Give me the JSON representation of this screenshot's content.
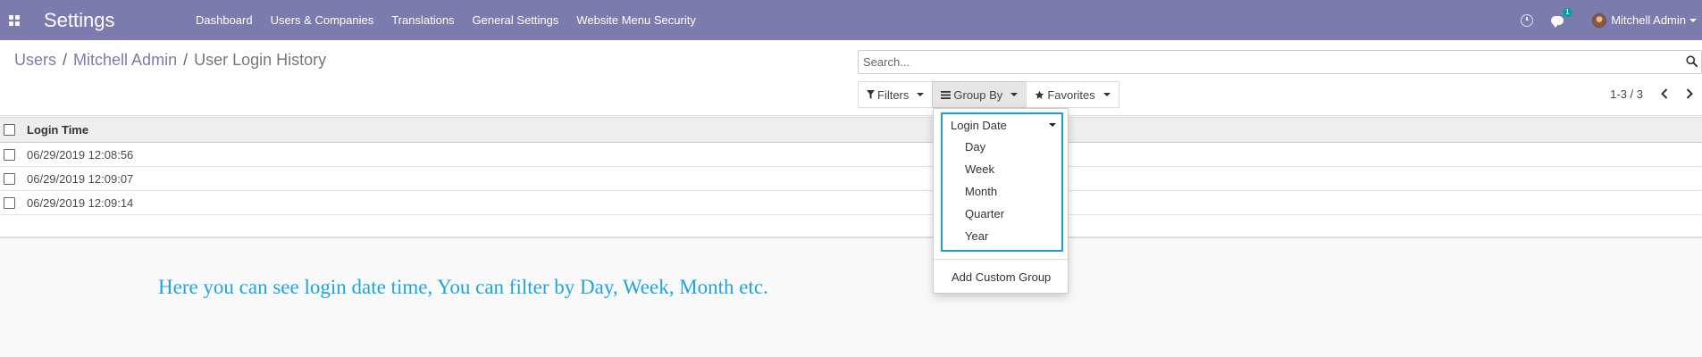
{
  "navbar": {
    "brand": "Settings",
    "menu": [
      "Dashboard",
      "Users & Companies",
      "Translations",
      "General Settings",
      "Website Menu Security"
    ],
    "chat_badge": "1",
    "user_name": "Mitchell Admin"
  },
  "breadcrumb": {
    "items": [
      "Users",
      "Mitchell Admin"
    ],
    "separator": "/",
    "active": "User Login History"
  },
  "search": {
    "placeholder": "Search...",
    "value": ""
  },
  "filters": {
    "filters_label": "Filters",
    "group_by_label": "Group By",
    "favorites_label": "Favorites"
  },
  "pager": {
    "value": "1-3 / 3"
  },
  "list": {
    "column": "Login Time",
    "rows": [
      "06/29/2019 12:08:56",
      "06/29/2019 12:09:07",
      "06/29/2019 12:09:14"
    ]
  },
  "group_by_dropdown": {
    "select_label": "Login Date",
    "options": [
      "Day",
      "Week",
      "Month",
      "Quarter",
      "Year"
    ],
    "custom_group_label": "Add Custom Group"
  },
  "note": "Here you can see login date time, You can filter by Day, Week, Month etc.",
  "colors": {
    "navbar": "#7c7bad",
    "link": "#7c7bad",
    "note": "#1ea5e0",
    "select_border": "#1d9bd8",
    "badge": "#00a09d"
  },
  "icons": {
    "apps": "apps-grid-icon",
    "clock": "clock-icon",
    "chat": "chat-icon",
    "search": "search-icon",
    "filter": "filter-icon",
    "group_by": "list-bars-icon",
    "favorites": "star-icon",
    "pager_prev": "chevron-left-icon",
    "pager_next": "chevron-right-icon"
  }
}
